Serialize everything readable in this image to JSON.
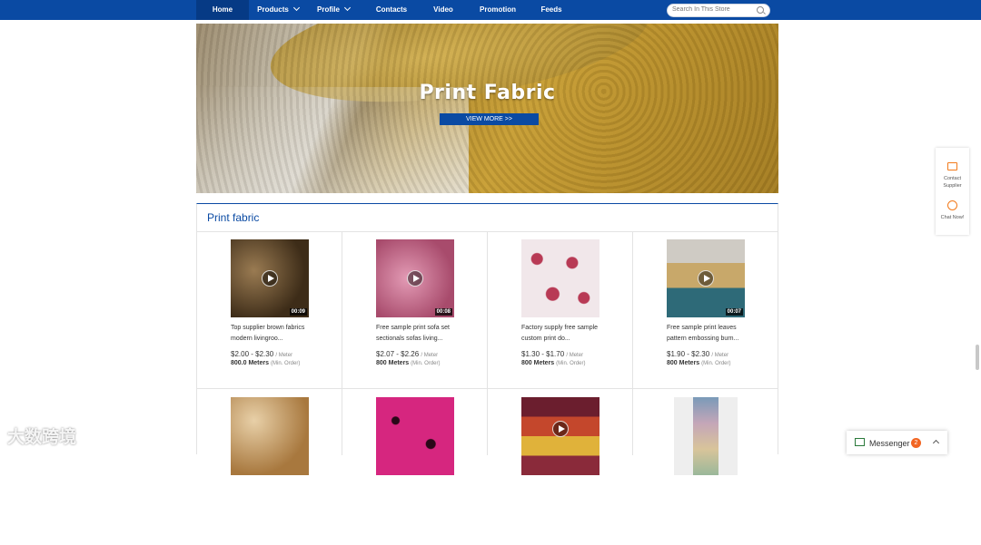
{
  "nav": {
    "items": [
      {
        "label": "Home",
        "active": true,
        "dropdown": false
      },
      {
        "label": "Products",
        "active": false,
        "dropdown": true
      },
      {
        "label": "Profile",
        "active": false,
        "dropdown": true
      },
      {
        "label": "Contacts",
        "active": false,
        "dropdown": false
      },
      {
        "label": "Video",
        "active": false,
        "dropdown": false
      },
      {
        "label": "Promotion",
        "active": false,
        "dropdown": false
      },
      {
        "label": "Feeds",
        "active": false,
        "dropdown": false
      }
    ],
    "search_placeholder": "Search In This Store"
  },
  "banner": {
    "title": "Print Fabric",
    "button": "VIEW MORE >>"
  },
  "section": {
    "title": "Print fabric",
    "products": [
      {
        "title": "Top supplier brown fabrics modern livingroo...",
        "price": "$2.00 - $2.30",
        "unit": "/ Meter",
        "moq": "800.0 Meters",
        "moq_note": "(Min. Order)",
        "duration": "00:09",
        "thumb_color": "#6b5535"
      },
      {
        "title": "Free sample print sofa set sectionals sofas living...",
        "price": "$2.07 - $2.26",
        "unit": "/ Meter",
        "moq": "800 Meters",
        "moq_note": "(Min. Order)",
        "duration": "00:08",
        "thumb_color": "#c46a8c"
      },
      {
        "title": "Factory supply free sample custom print do...",
        "price": "$1.30 - $1.70",
        "unit": "/ Meter",
        "moq": "800 Meters",
        "moq_note": "(Min. Order)",
        "duration": "",
        "thumb_color": "#ead8dc"
      },
      {
        "title": "Free sample print leaves pattern embossing burn...",
        "price": "$1.90 - $2.30",
        "unit": "/ Meter",
        "moq": "800 Meters",
        "moq_note": "(Min. Order)",
        "duration": "00:07",
        "thumb_color": "#b49a6e"
      }
    ],
    "second_row_colors": [
      "#c49a6a",
      "#d6267f",
      "#8a2a3a",
      "#dcd6e4"
    ]
  },
  "side": {
    "contact_label": "Contact Supplier",
    "chat_label": "Chat Now!"
  },
  "messenger": {
    "label": "Messenger",
    "badge": "2"
  },
  "watermark": "大数跨境",
  "colors": {
    "brand": "#0a4aa3",
    "accent": "#f27a1a"
  }
}
